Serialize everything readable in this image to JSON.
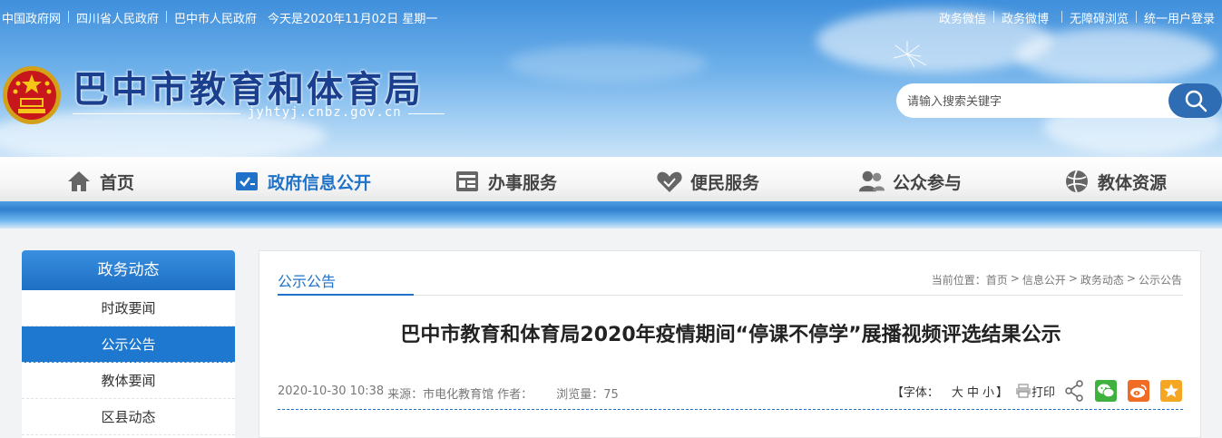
{
  "topbar": {
    "links": [
      "中国政府网",
      "四川省人民政府",
      "巴中市人民政府"
    ],
    "date_text": "今天是2020年11月02日 星期一",
    "right_links": [
      "政务微信",
      "政务微博",
      "无障碍浏览",
      "统一用户登录"
    ]
  },
  "site": {
    "title": "巴中市教育和体育局",
    "domain": "jyhtyj.cnbz.gov.cn"
  },
  "search": {
    "placeholder": "请输入搜索关键字"
  },
  "nav": {
    "items": [
      {
        "label": "首页",
        "icon": "home-icon"
      },
      {
        "label": "政府信息公开",
        "icon": "checklist-icon"
      },
      {
        "label": "办事服务",
        "icon": "service-icon"
      },
      {
        "label": "便民服务",
        "icon": "heart-hands-icon"
      },
      {
        "label": "公众参与",
        "icon": "people-icon"
      },
      {
        "label": "教体资源",
        "icon": "ball-icon"
      }
    ],
    "active_index": 1
  },
  "sidebar": {
    "heading": "政务动态",
    "items": [
      "时政要闻",
      "公示公告",
      "教体要闻",
      "区县动态"
    ],
    "active_index": 1
  },
  "main": {
    "tab_title": "公示公告",
    "breadcrumb": {
      "prefix": "当前位置：",
      "items": [
        "首页",
        "信息公开",
        "政务动态",
        "公示公告"
      ],
      "separator": ">"
    },
    "article_title": "巴中市教育和体育局2020年疫情期间“停课不停学”展播视频评选结果公示",
    "meta": {
      "datetime": "2020-10-30 10:38",
      "source": "来源：市电化教育馆",
      "author": "作者：",
      "views": "浏览量：75"
    },
    "tools": {
      "font_label": "【字体：",
      "font_large": "大",
      "font_medium": "中",
      "font_small": "小",
      "font_close": "】",
      "print_label": "打印"
    }
  },
  "colors": {
    "accent": "#1f72c8",
    "wechat": "#3eb13e",
    "weibo": "#f06c24",
    "favorite": "#f5a623"
  }
}
